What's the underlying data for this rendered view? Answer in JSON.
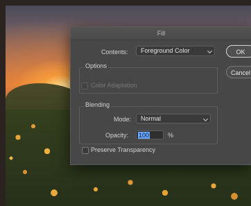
{
  "dialog": {
    "title": "Fill",
    "contents_label": "Contents:",
    "contents_value": "Foreground Color",
    "options_group": "Options",
    "color_adaptation_label": "Color Adaptation",
    "blending_group": "Blending",
    "mode_label": "Mode:",
    "mode_value": "Normal",
    "opacity_label": "Opacity:",
    "opacity_value": "100",
    "opacity_unit": "%",
    "preserve_label": "Preserve Transparency",
    "ok_label": "OK",
    "cancel_label": "Cancel"
  },
  "colors": {
    "dialog_bg": "#474747",
    "selection": "#6aa7ff"
  }
}
